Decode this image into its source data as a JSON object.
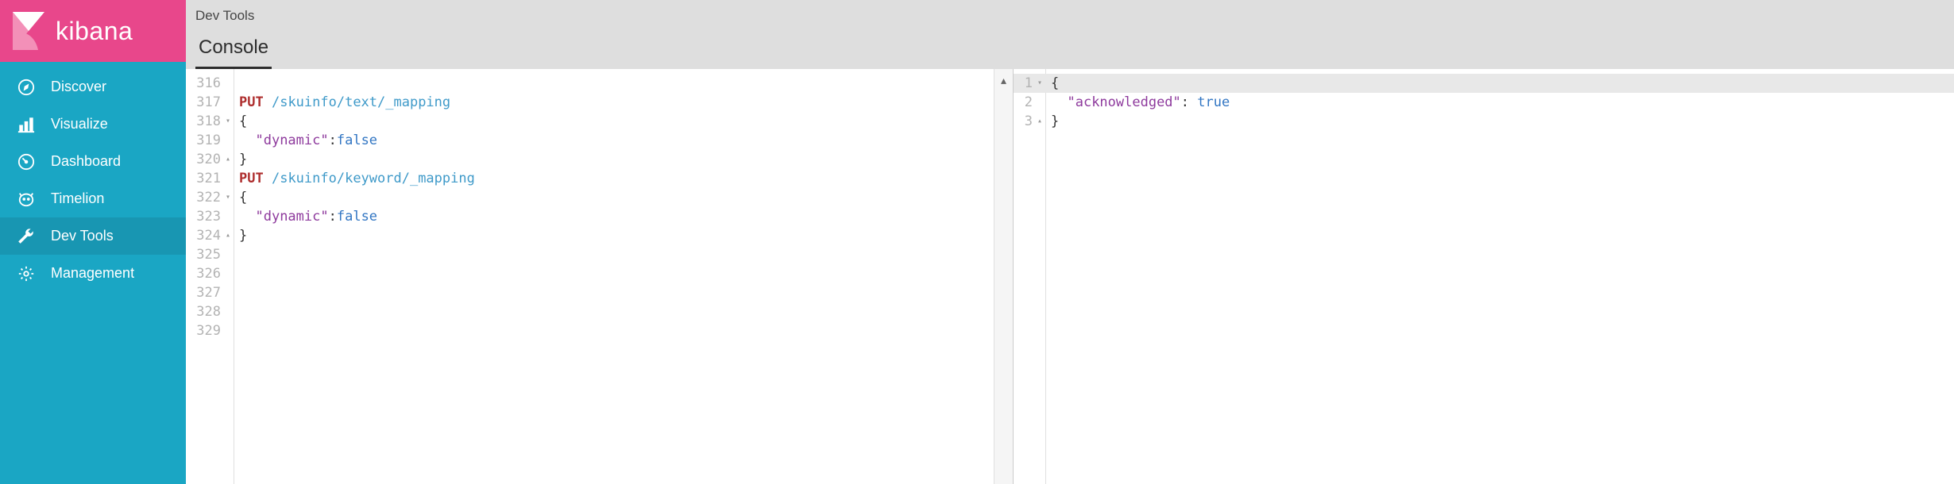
{
  "brand": {
    "name": "kibana"
  },
  "sidebar": {
    "items": [
      {
        "label": "Discover"
      },
      {
        "label": "Visualize"
      },
      {
        "label": "Dashboard"
      },
      {
        "label": "Timelion"
      },
      {
        "label": "Dev Tools"
      },
      {
        "label": "Management"
      }
    ]
  },
  "header": {
    "breadcrumb": "Dev Tools",
    "tab": "Console"
  },
  "request": {
    "lines": [
      {
        "n": "316",
        "fold": ""
      },
      {
        "n": "317",
        "fold": ""
      },
      {
        "n": "318",
        "fold": "▾"
      },
      {
        "n": "319",
        "fold": ""
      },
      {
        "n": "320",
        "fold": "▴"
      },
      {
        "n": "321",
        "fold": ""
      },
      {
        "n": "322",
        "fold": "▾"
      },
      {
        "n": "323",
        "fold": ""
      },
      {
        "n": "324",
        "fold": "▴"
      },
      {
        "n": "325",
        "fold": ""
      },
      {
        "n": "326",
        "fold": ""
      },
      {
        "n": "327",
        "fold": ""
      },
      {
        "n": "328",
        "fold": ""
      },
      {
        "n": "329",
        "fold": ""
      }
    ],
    "code": {
      "l317_method": "PUT",
      "l317_url": "/skuinfo/text/_mapping",
      "l318": "{",
      "l319_key": "\"dynamic\"",
      "l319_val": "false",
      "l320": "}",
      "l321_method": "PUT",
      "l321_url": "/skuinfo/keyword/_mapping",
      "l322": "{",
      "l323_key": "\"dynamic\"",
      "l323_val": "false",
      "l324": "}"
    }
  },
  "response": {
    "lines": [
      {
        "n": "1",
        "fold": "▾"
      },
      {
        "n": "2",
        "fold": ""
      },
      {
        "n": "3",
        "fold": "▴"
      }
    ],
    "code": {
      "l1": "{",
      "l2_key": "\"acknowledged\"",
      "l2_val": "true",
      "l3": "}"
    }
  }
}
